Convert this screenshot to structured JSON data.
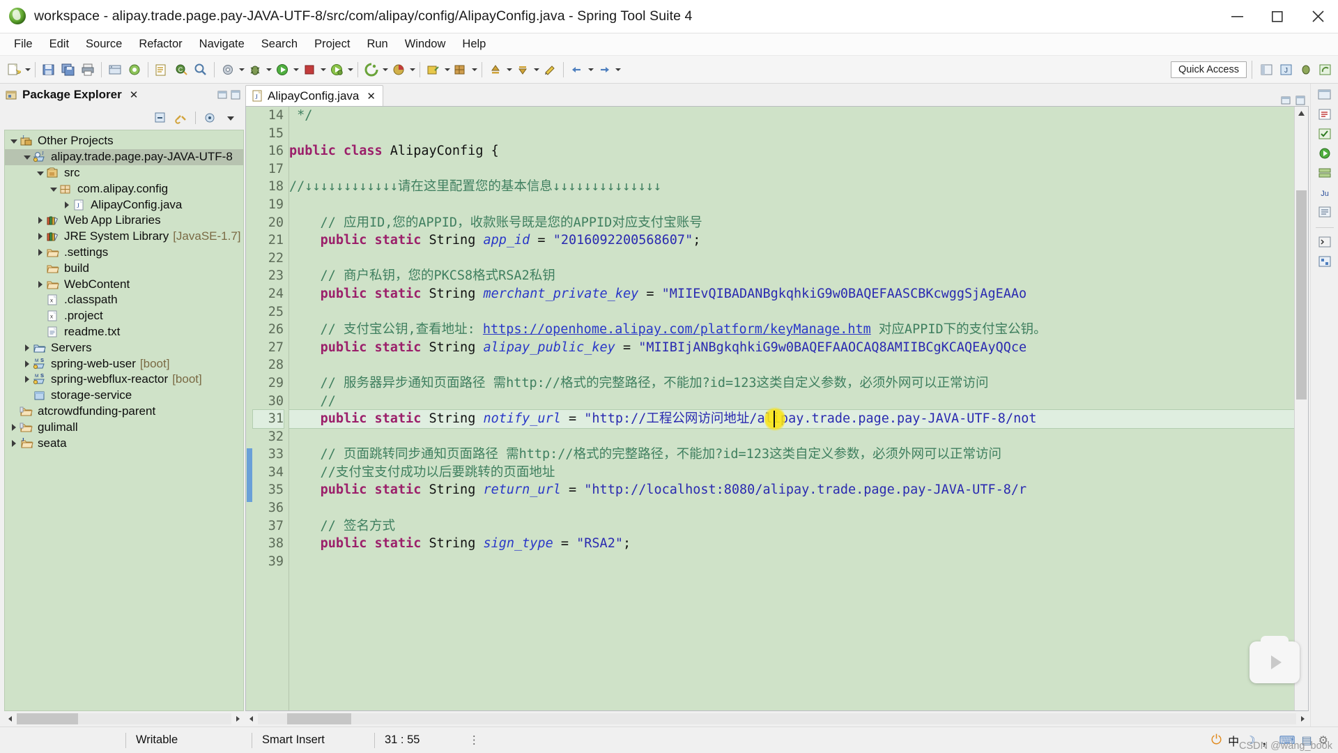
{
  "window": {
    "title": "workspace - alipay.trade.page.pay-JAVA-UTF-8/src/com/alipay/config/AlipayConfig.java - Spring Tool Suite 4",
    "app_icon": "spring-tool-suite-logo",
    "minimize": "–",
    "maximize": "☐",
    "close": "✕"
  },
  "menubar": {
    "items": [
      {
        "label": "File"
      },
      {
        "label": "Edit"
      },
      {
        "label": "Source"
      },
      {
        "label": "Refactor"
      },
      {
        "label": "Navigate"
      },
      {
        "label": "Search"
      },
      {
        "label": "Project"
      },
      {
        "label": "Run"
      },
      {
        "label": "Window"
      },
      {
        "label": "Help"
      }
    ]
  },
  "toolbar": {
    "quick_access": "Quick Access",
    "buttons": [
      {
        "name": "new-wizard",
        "color": "#e8d46a"
      },
      {
        "name": "save",
        "color": "#6f93c9"
      },
      {
        "name": "save-all",
        "color": "#6f93c9"
      },
      {
        "name": "print",
        "color": "#8f9aa5"
      },
      {
        "name": "build-all",
        "color": "#c0cfe0"
      },
      {
        "name": "debug",
        "color": "#7fba4c"
      },
      {
        "name": "run",
        "color": "#4fae3f"
      },
      {
        "name": "run-external-tools",
        "color": "#c95f2a"
      },
      {
        "name": "boot-dashboard",
        "color": "#d8d85a"
      },
      {
        "name": "new-spring-starter",
        "color": "#8bc34a"
      },
      {
        "name": "open-type",
        "color": "#f0c040"
      },
      {
        "name": "search",
        "color": "#6f93c9"
      },
      {
        "name": "coverage",
        "color": "#c23b3b"
      },
      {
        "name": "new-java-project",
        "color": "#5b8f3e"
      },
      {
        "name": "new-java-class",
        "color": "#3f7a2e"
      },
      {
        "name": "external-tools",
        "color": "#77a6d6"
      },
      {
        "name": "skip-breakpoints",
        "color": "#8fa8c8"
      },
      {
        "name": "next-annotation",
        "color": "#d0a43a"
      },
      {
        "name": "previous-annotation",
        "color": "#d0a43a"
      },
      {
        "name": "last-edit-location",
        "color": "#d7b24a"
      },
      {
        "name": "back",
        "color": "#4e7fbf"
      },
      {
        "name": "forward",
        "color": "#4e7fbf"
      }
    ],
    "right_icons": [
      {
        "name": "open-perspective"
      },
      {
        "name": "java-perspective"
      },
      {
        "name": "debug-perspective"
      },
      {
        "name": "spring-perspective"
      }
    ]
  },
  "package_explorer": {
    "title": "Package Explorer",
    "close_glyph": "✕",
    "view_buttons": [
      {
        "name": "collapse-all"
      },
      {
        "name": "link-with-editor"
      },
      {
        "name": "focus-on-active-task"
      },
      {
        "name": "view-menu"
      }
    ],
    "tree": [
      {
        "label": "Other Projects",
        "indent": 0,
        "twist": "open",
        "icon": "java-projects-folder",
        "selected": false,
        "dim": ""
      },
      {
        "label": "alipay.trade.page.pay-JAVA-UTF-8",
        "indent": 1,
        "twist": "open",
        "icon": "web-project",
        "selected": true,
        "dim": ""
      },
      {
        "label": "src",
        "indent": 2,
        "twist": "open",
        "icon": "source-folder",
        "selected": false,
        "dim": ""
      },
      {
        "label": "com.alipay.config",
        "indent": 3,
        "twist": "open",
        "icon": "package",
        "selected": false,
        "dim": ""
      },
      {
        "label": "AlipayConfig.java",
        "indent": 4,
        "twist": "closed",
        "icon": "java-file",
        "selected": false,
        "dim": ""
      },
      {
        "label": "Web App Libraries",
        "indent": 2,
        "twist": "closed",
        "icon": "library",
        "selected": false,
        "dim": ""
      },
      {
        "label": "JRE System Library",
        "indent": 2,
        "twist": "closed",
        "icon": "library",
        "selected": false,
        "dim": "[JavaSE-1.7]"
      },
      {
        "label": ".settings",
        "indent": 2,
        "twist": "closed",
        "icon": "folder",
        "selected": false,
        "dim": ""
      },
      {
        "label": "build",
        "indent": 2,
        "twist": "none",
        "icon": "folder",
        "selected": false,
        "dim": ""
      },
      {
        "label": "WebContent",
        "indent": 2,
        "twist": "closed",
        "icon": "folder",
        "selected": false,
        "dim": ""
      },
      {
        "label": ".classpath",
        "indent": 2,
        "twist": "none",
        "icon": "xml-file",
        "selected": false,
        "dim": ""
      },
      {
        "label": ".project",
        "indent": 2,
        "twist": "none",
        "icon": "xml-file",
        "selected": false,
        "dim": ""
      },
      {
        "label": "readme.txt",
        "indent": 2,
        "twist": "none",
        "icon": "text-file",
        "selected": false,
        "dim": ""
      },
      {
        "label": "Servers",
        "indent": 1,
        "twist": "closed",
        "icon": "servers-folder",
        "selected": false,
        "dim": ""
      },
      {
        "label": "spring-web-user",
        "indent": 1,
        "twist": "closed",
        "icon": "spring-boot-project",
        "selected": false,
        "dim": "[boot]"
      },
      {
        "label": "spring-webflux-reactor",
        "indent": 1,
        "twist": "closed",
        "icon": "spring-boot-project",
        "selected": false,
        "dim": "[boot]"
      },
      {
        "label": "storage-service",
        "indent": 1,
        "twist": "none",
        "icon": "closed-project",
        "selected": false,
        "dim": ""
      },
      {
        "label": "atcrowdfunding-parent",
        "indent": 0,
        "twist": "none",
        "icon": "maven-project",
        "selected": false,
        "dim": ""
      },
      {
        "label": "gulimall",
        "indent": 0,
        "twist": "closed",
        "icon": "maven-project",
        "selected": false,
        "dim": ""
      },
      {
        "label": "seata",
        "indent": 0,
        "twist": "closed",
        "icon": "java-project",
        "selected": false,
        "dim": ""
      }
    ]
  },
  "editor": {
    "tab": {
      "label": "AlipayConfig.java",
      "icon": "java-file",
      "close_glyph": "✕"
    },
    "first_line_number": 14,
    "highlighted_line": 31,
    "lines": [
      {
        "n": 14,
        "tokens": [
          {
            "t": " */",
            "c": "cmt"
          }
        ]
      },
      {
        "n": 15,
        "tokens": []
      },
      {
        "n": 16,
        "tokens": [
          {
            "t": "public class ",
            "c": "kw"
          },
          {
            "t": "AlipayConfig {",
            "c": "plain"
          }
        ]
      },
      {
        "n": 17,
        "tokens": []
      },
      {
        "n": 18,
        "tokens": [
          {
            "t": "//↓↓↓↓↓↓↓↓↓↓↓↓请在这里配置您的基本信息↓↓↓↓↓↓↓↓↓↓↓↓↓↓",
            "c": "cmt"
          }
        ]
      },
      {
        "n": 19,
        "tokens": []
      },
      {
        "n": 20,
        "tokens": [
          {
            "t": "    // 应用ID,您的APPID，收款账号既是您的APPID对应支付宝账号",
            "c": "cmt"
          }
        ]
      },
      {
        "n": 21,
        "tokens": [
          {
            "t": "    ",
            "c": "plain"
          },
          {
            "t": "public static ",
            "c": "kw"
          },
          {
            "t": "String ",
            "c": "plain"
          },
          {
            "t": "app_id",
            "c": "fld"
          },
          {
            "t": " = ",
            "c": "plain"
          },
          {
            "t": "\"2016092200568607\"",
            "c": "str"
          },
          {
            "t": ";",
            "c": "plain"
          }
        ]
      },
      {
        "n": 22,
        "tokens": []
      },
      {
        "n": 23,
        "tokens": [
          {
            "t": "    // 商户私钥，您的PKCS8格式RSA2私钥",
            "c": "cmt"
          }
        ]
      },
      {
        "n": 24,
        "tokens": [
          {
            "t": "    ",
            "c": "plain"
          },
          {
            "t": "public static ",
            "c": "kw"
          },
          {
            "t": "String ",
            "c": "plain"
          },
          {
            "t": "merchant_private_key",
            "c": "fld"
          },
          {
            "t": " = ",
            "c": "plain"
          },
          {
            "t": "\"MIIEvQIBADANBgkqhkiG9w0BAQEFAASCBKcwggSjAgEAAo",
            "c": "str"
          }
        ]
      },
      {
        "n": 25,
        "tokens": []
      },
      {
        "n": 26,
        "tokens": [
          {
            "t": "    // 支付宝公钥,查看地址: ",
            "c": "cmt"
          },
          {
            "t": "https://openhome.alipay.com/platform/keyManage.htm",
            "c": "lnk"
          },
          {
            "t": " 对应APPID下的支付宝公钥。",
            "c": "cmt"
          }
        ]
      },
      {
        "n": 27,
        "tokens": [
          {
            "t": "    ",
            "c": "plain"
          },
          {
            "t": "public static ",
            "c": "kw"
          },
          {
            "t": "String ",
            "c": "plain"
          },
          {
            "t": "alipay_public_key",
            "c": "fld"
          },
          {
            "t": " = ",
            "c": "plain"
          },
          {
            "t": "\"MIIBIjANBgkqhkiG9w0BAQEFAAOCAQ8AMIIBCgKCAQEAyQQce",
            "c": "str"
          }
        ]
      },
      {
        "n": 28,
        "tokens": []
      },
      {
        "n": 29,
        "tokens": [
          {
            "t": "    // 服务器异步通知页面路径 需http://格式的完整路径，不能加?id=123这类自定义参数，必须外网可以正常访问",
            "c": "cmt"
          }
        ]
      },
      {
        "n": 30,
        "tokens": [
          {
            "t": "    //",
            "c": "cmt"
          }
        ]
      },
      {
        "n": 31,
        "tokens": [
          {
            "t": "    ",
            "c": "plain"
          },
          {
            "t": "public static ",
            "c": "kw"
          },
          {
            "t": "String ",
            "c": "plain"
          },
          {
            "t": "notify_url",
            "c": "fld"
          },
          {
            "t": " = ",
            "c": "plain"
          },
          {
            "t": "\"http://工程公网访问地址/alipay.trade.page.pay-JAVA-UTF-8/not",
            "c": "str"
          }
        ]
      },
      {
        "n": 32,
        "tokens": []
      },
      {
        "n": 33,
        "tokens": [
          {
            "t": "    // 页面跳转同步通知页面路径 需http://格式的完整路径，不能加?id=123这类自定义参数，必须外网可以正常访问",
            "c": "cmt"
          }
        ]
      },
      {
        "n": 34,
        "tokens": [
          {
            "t": "    //支付宝支付成功以后要跳转的页面地址",
            "c": "cmt"
          }
        ]
      },
      {
        "n": 35,
        "tokens": [
          {
            "t": "    ",
            "c": "plain"
          },
          {
            "t": "public static ",
            "c": "kw"
          },
          {
            "t": "String ",
            "c": "plain"
          },
          {
            "t": "return_url",
            "c": "fld"
          },
          {
            "t": " = ",
            "c": "plain"
          },
          {
            "t": "\"http://localhost:8080/alipay.trade.page.pay-JAVA-UTF-8/r",
            "c": "str"
          }
        ]
      },
      {
        "n": 36,
        "tokens": []
      },
      {
        "n": 37,
        "tokens": [
          {
            "t": "    // 签名方式",
            "c": "cmt"
          }
        ]
      },
      {
        "n": 38,
        "tokens": [
          {
            "t": "    ",
            "c": "plain"
          },
          {
            "t": "public static ",
            "c": "kw"
          },
          {
            "t": "String ",
            "c": "plain"
          },
          {
            "t": "sign_type",
            "c": "fld"
          },
          {
            "t": " = ",
            "c": "plain"
          },
          {
            "t": "\"RSA2\"",
            "c": "str"
          },
          {
            "t": ";",
            "c": "plain"
          }
        ]
      },
      {
        "n": 39,
        "tokens": []
      }
    ]
  },
  "statusbar": {
    "writable": "Writable",
    "insert_mode": "Smart Insert",
    "position": "31 : 55",
    "dots": "⋮",
    "tray": {
      "ime_power": "⏻",
      "ime_lang": "中",
      "ime_moon": "☽",
      "ime_comma": "，",
      "keyboard": "⌨",
      "tray_a": "▤",
      "tray_b": "⚙"
    }
  },
  "watermark": "CSDN @wang_book"
}
